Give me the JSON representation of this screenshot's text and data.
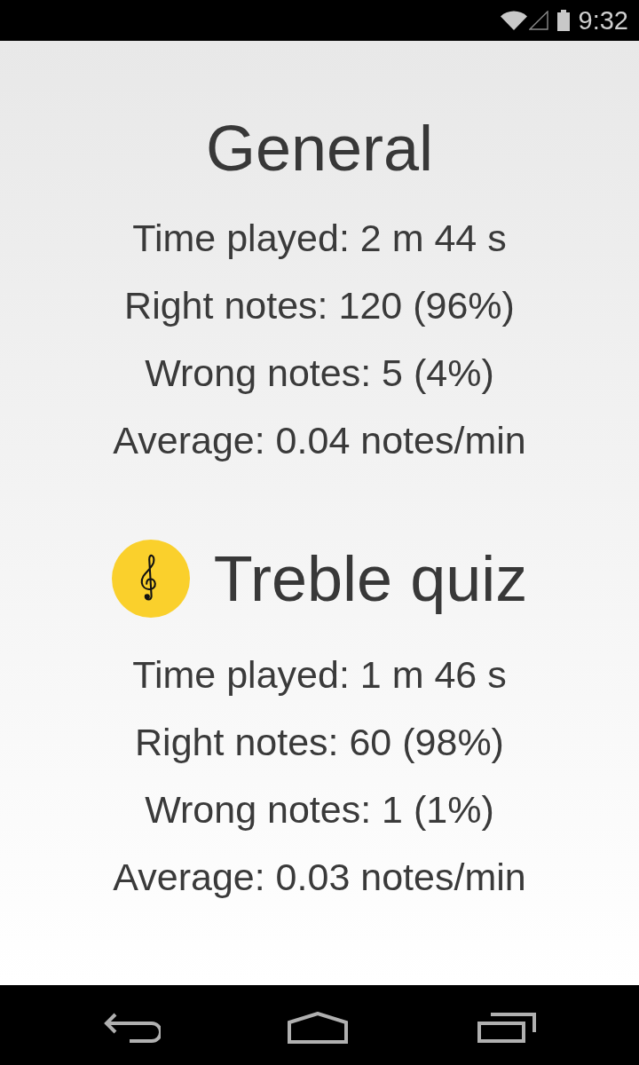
{
  "status_bar": {
    "time": "9:32"
  },
  "sections": [
    {
      "kind": "general",
      "title": "General",
      "stats": [
        "Time played: 2 m 44 s",
        "Right notes: 120 (96%)",
        "Wrong notes: 5 (4%)",
        "Average: 0.04 notes/min"
      ]
    },
    {
      "kind": "quiz",
      "title": "Treble quiz",
      "stats": [
        "Time played: 1 m 46 s",
        "Right notes: 60 (98%)",
        "Wrong notes: 1 (1%)",
        "Average: 0.03 notes/min"
      ]
    }
  ]
}
